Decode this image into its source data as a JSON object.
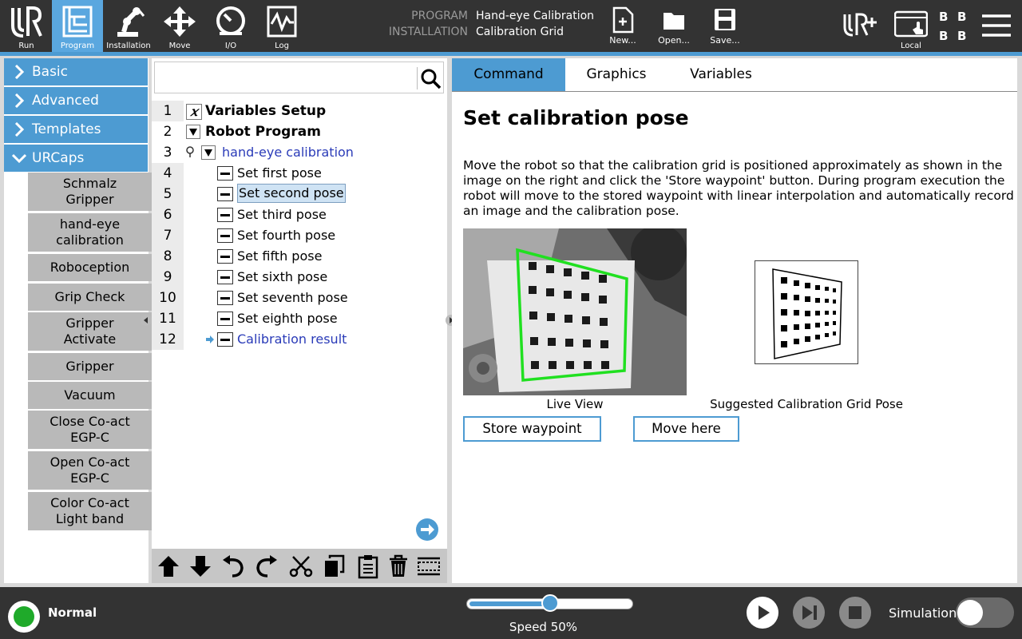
{
  "nav": [
    {
      "label": "Run",
      "icon": "ur-logo-icon"
    },
    {
      "label": "Program",
      "icon": "program-tree-icon"
    },
    {
      "label": "Installation",
      "icon": "robot-arm-icon"
    },
    {
      "label": "Move",
      "icon": "move-arrows-icon"
    },
    {
      "label": "I/O",
      "icon": "io-gauge-icon"
    },
    {
      "label": "Log",
      "icon": "log-chart-icon"
    }
  ],
  "header": {
    "program_label": "PROGRAM",
    "program_name": "Hand-eye Calibration",
    "installation_label": "INSTALLATION",
    "installation_name": "Calibration Grid"
  },
  "file_buttons": {
    "new": "New...",
    "open": "Open...",
    "save": "Save..."
  },
  "top_right": {
    "mode_label": "Local",
    "bb": [
      "B",
      "B",
      "B",
      "B"
    ]
  },
  "palette": {
    "categories": [
      "Basic",
      "Advanced",
      "Templates",
      "URCaps"
    ],
    "urcaps": [
      "Schmalz Gripper",
      "hand-eye calibration",
      "Roboception",
      "Grip Check",
      "Gripper Activate",
      "Gripper",
      "Vacuum",
      "Close Co-act EGP-C",
      "Open Co-act EGP-C",
      "Color Co-act Light band"
    ]
  },
  "tree": {
    "search_placeholder": "",
    "lines": [
      {
        "num": "1",
        "text": "Variables Setup"
      },
      {
        "num": "2",
        "text": "Robot Program"
      },
      {
        "num": "3",
        "text": "hand-eye calibration"
      },
      {
        "num": "4",
        "text": "Set first pose"
      },
      {
        "num": "5",
        "text": "Set second pose"
      },
      {
        "num": "6",
        "text": "Set third pose"
      },
      {
        "num": "7",
        "text": "Set fourth pose"
      },
      {
        "num": "8",
        "text": "Set fifth pose"
      },
      {
        "num": "9",
        "text": "Set sixth pose"
      },
      {
        "num": "10",
        "text": "Set seventh pose"
      },
      {
        "num": "11",
        "text": "Set eighth pose"
      },
      {
        "num": "12",
        "text": "Calibration result"
      }
    ],
    "selected": "Set second pose"
  },
  "right": {
    "tabs": [
      "Command",
      "Graphics",
      "Variables"
    ],
    "active_tab": "Command",
    "title": "Set calibration pose",
    "description": "Move the robot so that the calibration grid is positioned approximately as shown in the image on the right and click the 'Store waypoint' button. During program execution the robot will move to the stored waypoint with linear interpolation and automatically record an image and the calibration pose.",
    "live_caption": "Live View",
    "grid_caption": "Suggested Calibration Grid Pose",
    "store_button": "Store waypoint",
    "move_button": "Move here"
  },
  "bottom": {
    "status": "Normal",
    "speed_label": "Speed 50%",
    "speed_value": 0.5,
    "simulation_label": "Simulation",
    "simulation_on": false
  },
  "colors": {
    "accent": "#4d9bd2",
    "bar": "#333333",
    "status_ok": "#1faa2a",
    "link_blue": "#2a3bb8",
    "grid_green": "#20e020"
  }
}
